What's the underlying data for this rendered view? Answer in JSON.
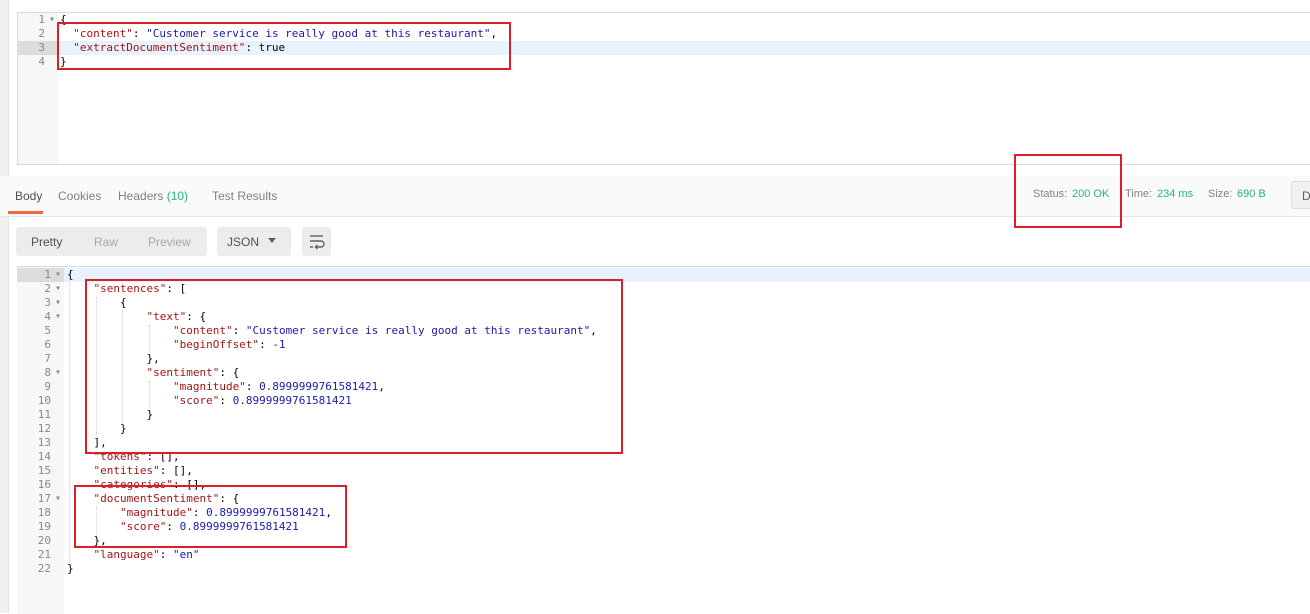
{
  "request": {
    "lines": [
      {
        "num": "1",
        "fold": true,
        "parts": [
          {
            "t": "{",
            "c": "p"
          }
        ]
      },
      {
        "num": "2",
        "fold": false,
        "parts": [
          {
            "t": "  \"content\"",
            "c": "k"
          },
          {
            "t": ": ",
            "c": "p"
          },
          {
            "t": "\"Customer service is really good at this restaurant\"",
            "c": "s"
          },
          {
            "t": ",",
            "c": "p"
          }
        ]
      },
      {
        "num": "3",
        "fold": false,
        "parts": [
          {
            "t": "  \"extractDocumentSentiment\"",
            "c": "k"
          },
          {
            "t": ": true",
            "c": "p"
          }
        ]
      },
      {
        "num": "4",
        "fold": false,
        "parts": [
          {
            "t": "}",
            "c": "p"
          }
        ]
      }
    ]
  },
  "tabs": {
    "body": "Body",
    "cookies": "Cookies",
    "headers": "Headers",
    "headers_count": "(10)",
    "test_results": "Test Results"
  },
  "meta": {
    "status_label": "Status:",
    "status_value": "200 OK",
    "time_label": "Time:",
    "time_value": "234 ms",
    "size_label": "Size:",
    "size_value": "690 B",
    "overflow_button": "D"
  },
  "toolbar": {
    "pretty": "Pretty",
    "raw": "Raw",
    "preview": "Preview",
    "format": "JSON"
  },
  "response": {
    "lines": [
      {
        "num": "1",
        "fold": true,
        "parts": [
          {
            "t": "{",
            "c": "p"
          }
        ]
      },
      {
        "num": "2",
        "fold": true,
        "parts": [
          {
            "t": "    \"sentences\"",
            "c": "k"
          },
          {
            "t": ": [",
            "c": "p"
          }
        ]
      },
      {
        "num": "3",
        "fold": true,
        "parts": [
          {
            "t": "        {",
            "c": "p"
          }
        ]
      },
      {
        "num": "4",
        "fold": true,
        "parts": [
          {
            "t": "            \"text\"",
            "c": "k"
          },
          {
            "t": ": {",
            "c": "p"
          }
        ]
      },
      {
        "num": "5",
        "fold": false,
        "parts": [
          {
            "t": "                \"content\"",
            "c": "k"
          },
          {
            "t": ": ",
            "c": "p"
          },
          {
            "t": "\"Customer service is really good at this restaurant\"",
            "c": "s"
          },
          {
            "t": ",",
            "c": "p"
          }
        ]
      },
      {
        "num": "6",
        "fold": false,
        "parts": [
          {
            "t": "                \"beginOffset\"",
            "c": "k"
          },
          {
            "t": ": ",
            "c": "p"
          },
          {
            "t": "-1",
            "c": "n"
          }
        ]
      },
      {
        "num": "7",
        "fold": false,
        "parts": [
          {
            "t": "            },",
            "c": "p"
          }
        ]
      },
      {
        "num": "8",
        "fold": true,
        "parts": [
          {
            "t": "            \"sentiment\"",
            "c": "k"
          },
          {
            "t": ": {",
            "c": "p"
          }
        ]
      },
      {
        "num": "9",
        "fold": false,
        "parts": [
          {
            "t": "                \"magnitude\"",
            "c": "k"
          },
          {
            "t": ": ",
            "c": "p"
          },
          {
            "t": "0.8999999761581421",
            "c": "n"
          },
          {
            "t": ",",
            "c": "p"
          }
        ]
      },
      {
        "num": "10",
        "fold": false,
        "parts": [
          {
            "t": "                \"score\"",
            "c": "k"
          },
          {
            "t": ": ",
            "c": "p"
          },
          {
            "t": "0.8999999761581421",
            "c": "n"
          }
        ]
      },
      {
        "num": "11",
        "fold": false,
        "parts": [
          {
            "t": "            }",
            "c": "p"
          }
        ]
      },
      {
        "num": "12",
        "fold": false,
        "parts": [
          {
            "t": "        }",
            "c": "p"
          }
        ]
      },
      {
        "num": "13",
        "fold": false,
        "parts": [
          {
            "t": "    ],",
            "c": "p"
          }
        ]
      },
      {
        "num": "14",
        "fold": false,
        "parts": [
          {
            "t": "    \"tokens\"",
            "c": "k"
          },
          {
            "t": ": [],",
            "c": "p"
          }
        ]
      },
      {
        "num": "15",
        "fold": false,
        "parts": [
          {
            "t": "    \"entities\"",
            "c": "k"
          },
          {
            "t": ": [],",
            "c": "p"
          }
        ]
      },
      {
        "num": "16",
        "fold": false,
        "parts": [
          {
            "t": "    \"categories\"",
            "c": "k"
          },
          {
            "t": ": [],",
            "c": "p"
          }
        ]
      },
      {
        "num": "17",
        "fold": true,
        "parts": [
          {
            "t": "    \"documentSentiment\"",
            "c": "k"
          },
          {
            "t": ": {",
            "c": "p"
          }
        ]
      },
      {
        "num": "18",
        "fold": false,
        "parts": [
          {
            "t": "        \"magnitude\"",
            "c": "k"
          },
          {
            "t": ": ",
            "c": "p"
          },
          {
            "t": "0.8999999761581421",
            "c": "n"
          },
          {
            "t": ",",
            "c": "p"
          }
        ]
      },
      {
        "num": "19",
        "fold": false,
        "parts": [
          {
            "t": "        \"score\"",
            "c": "k"
          },
          {
            "t": ": ",
            "c": "p"
          },
          {
            "t": "0.8999999761581421",
            "c": "n"
          }
        ]
      },
      {
        "num": "20",
        "fold": false,
        "parts": [
          {
            "t": "    },",
            "c": "p"
          }
        ]
      },
      {
        "num": "21",
        "fold": false,
        "parts": [
          {
            "t": "    \"language\"",
            "c": "k"
          },
          {
            "t": ": ",
            "c": "p"
          },
          {
            "t": "\"en\"",
            "c": "s"
          }
        ]
      },
      {
        "num": "22",
        "fold": false,
        "parts": [
          {
            "t": "}",
            "c": "p"
          }
        ]
      }
    ]
  },
  "colors": {
    "accent_tab": "#f26b3a",
    "status_green": "#26b47f",
    "annotation_red": "#dd1e26",
    "json_key": "#a31515",
    "json_string": "#1a1aa6"
  }
}
